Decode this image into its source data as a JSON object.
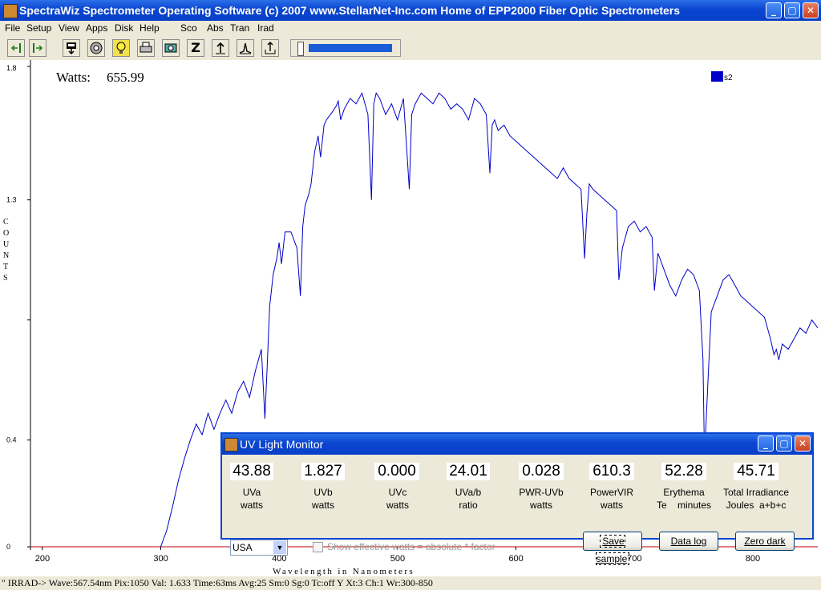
{
  "window": {
    "title": "SpectraWiz  Spectrometer Operating Software (c) 2007  www.StellarNet-Inc.com  Home of EPP2000 Fiber Optic Spectrometers",
    "minimize_glyph": "_",
    "maximize_glyph": "▢",
    "close_glyph": "✕"
  },
  "menu": [
    "File",
    "Setup",
    "View",
    "Apps",
    "Disk",
    "Help",
    "Sco",
    "Abs",
    "Tran",
    "Irad"
  ],
  "toolbar": {
    "buttons": [
      "arrow-left-bar-icon",
      "arrow-right-bar-icon",
      "download-icon",
      "target-icon",
      "lightbulb-icon",
      "printer-icon",
      "camera-icon",
      "z-icon",
      "upload-icon",
      "peak-icon",
      "export-icon"
    ],
    "z_glyph": "Z",
    "slider_value": 1.0
  },
  "chart_data": {
    "type": "line",
    "annotation_label": "Watts:",
    "annotation_value": "655.99",
    "legend": [
      "s2"
    ],
    "series_color": "#0000c8",
    "ylabel": "COUNTS",
    "xlabel": "Wavelength in Nanometers",
    "xlim": [
      190,
      855
    ],
    "ylim": [
      0,
      1.8
    ],
    "xticks": [
      200,
      300,
      400,
      500,
      600,
      700,
      800
    ],
    "yticks": [
      0,
      0.4,
      1.3,
      1.8
    ],
    "ytick_marks_unlabeled": [
      0.85
    ],
    "x": [
      300,
      305,
      310,
      315,
      320,
      325,
      330,
      335,
      340,
      345,
      350,
      355,
      360,
      365,
      370,
      375,
      380,
      385,
      388,
      390,
      392,
      395,
      398,
      400,
      402,
      405,
      410,
      415,
      418,
      420,
      422,
      425,
      427,
      430,
      433,
      435,
      438,
      440,
      445,
      448,
      450,
      452,
      455,
      460,
      465,
      470,
      475,
      478,
      480,
      482,
      485,
      490,
      495,
      500,
      505,
      510,
      512,
      515,
      520,
      525,
      530,
      535,
      540,
      545,
      550,
      555,
      560,
      565,
      570,
      575,
      578,
      580,
      582,
      585,
      590,
      595,
      600,
      605,
      610,
      615,
      620,
      625,
      630,
      635,
      640,
      645,
      650,
      655,
      658,
      660,
      662,
      665,
      670,
      675,
      680,
      685,
      687,
      690,
      695,
      700,
      705,
      710,
      715,
      717,
      720,
      725,
      730,
      735,
      740,
      745,
      750,
      755,
      758,
      759,
      760,
      762,
      765,
      770,
      775,
      780,
      785,
      790,
      795,
      800,
      805,
      810,
      815,
      818,
      820,
      822,
      825,
      830,
      835,
      840,
      845,
      850,
      855
    ],
    "y": [
      0.0,
      0.06,
      0.15,
      0.25,
      0.33,
      0.4,
      0.46,
      0.42,
      0.5,
      0.44,
      0.5,
      0.55,
      0.5,
      0.58,
      0.62,
      0.56,
      0.66,
      0.74,
      0.48,
      0.68,
      0.9,
      1.02,
      1.08,
      1.14,
      1.06,
      1.18,
      1.18,
      1.12,
      0.94,
      1.2,
      1.28,
      1.32,
      1.36,
      1.48,
      1.54,
      1.46,
      1.58,
      1.6,
      1.63,
      1.65,
      1.67,
      1.6,
      1.64,
      1.68,
      1.66,
      1.7,
      1.62,
      1.3,
      1.66,
      1.7,
      1.68,
      1.62,
      1.66,
      1.6,
      1.68,
      1.34,
      1.62,
      1.66,
      1.7,
      1.68,
      1.66,
      1.7,
      1.68,
      1.64,
      1.66,
      1.64,
      1.6,
      1.68,
      1.66,
      1.62,
      1.4,
      1.58,
      1.6,
      1.56,
      1.58,
      1.54,
      1.52,
      1.5,
      1.48,
      1.46,
      1.44,
      1.42,
      1.4,
      1.38,
      1.42,
      1.38,
      1.36,
      1.34,
      1.08,
      1.25,
      1.36,
      1.34,
      1.32,
      1.3,
      1.28,
      1.26,
      1.0,
      1.12,
      1.2,
      1.22,
      1.18,
      1.2,
      1.16,
      0.96,
      1.1,
      1.04,
      0.98,
      0.94,
      1.0,
      1.04,
      1.02,
      0.96,
      0.7,
      0.42,
      0.4,
      0.6,
      0.88,
      0.94,
      1.0,
      1.02,
      0.98,
      0.94,
      0.92,
      0.9,
      0.88,
      0.86,
      0.78,
      0.72,
      0.74,
      0.7,
      0.76,
      0.74,
      0.78,
      0.82,
      0.8,
      0.85,
      0.82
    ]
  },
  "uv_monitor": {
    "title": "UV Light Monitor",
    "readouts": [
      {
        "value": "43.88",
        "label": "UVa",
        "unit": "watts"
      },
      {
        "value": "1.827",
        "label": "UVb",
        "unit": "watts"
      },
      {
        "value": "0.000",
        "label": "UVc",
        "unit": "watts"
      },
      {
        "value": "24.01",
        "label": "UVa/b",
        "unit": "ratio"
      },
      {
        "value": "0.028",
        "label": "PWR-UVb",
        "unit": "watts"
      },
      {
        "value": "610.3",
        "label": "PowerVIR",
        "unit": "watts"
      },
      {
        "value": "52.28",
        "label": "Erythema",
        "unit": "Te    minutes"
      },
      {
        "value": "45.71",
        "label": "Total Irradiance",
        "unit": "Joules  a+b+c"
      }
    ],
    "region_select": "USA",
    "checkbox_label": "Show effective watts = absolute * factor",
    "checkbox_checked": false,
    "buttons": [
      "Save sample",
      "Data log",
      "Zero dark"
    ]
  },
  "status_bar": "\" IRRAD->  Wave:567.54nm  Pix:1050  Val:  1.633  Time:63ms  Avg:25  Sm:0  Sg:0  Tc:off Y  Xt:3  Ch:1  Wr:300-850"
}
